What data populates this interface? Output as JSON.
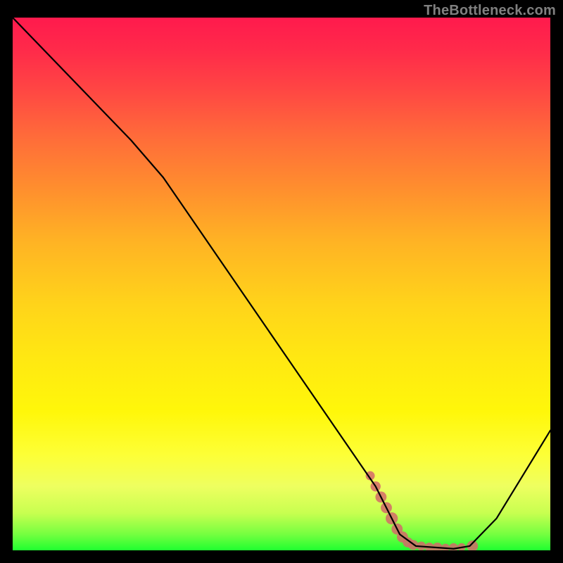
{
  "watermark_text": "TheBottleneck.com",
  "chart_data": {
    "type": "line",
    "title": "",
    "xlabel": "",
    "ylabel": "",
    "xlim": [
      0,
      100
    ],
    "ylim": [
      0,
      100
    ],
    "curve": {
      "name": "bottleneck-curve",
      "color": "#000000",
      "points_pct": [
        {
          "x": 0.0,
          "y": 100.0
        },
        {
          "x": 22.0,
          "y": 77.0
        },
        {
          "x": 28.0,
          "y": 70.0
        },
        {
          "x": 67.5,
          "y": 12.0
        },
        {
          "x": 72.0,
          "y": 3.0
        },
        {
          "x": 75.0,
          "y": 0.8
        },
        {
          "x": 82.0,
          "y": 0.3
        },
        {
          "x": 85.0,
          "y": 0.8
        },
        {
          "x": 90.0,
          "y": 6.0
        },
        {
          "x": 100.0,
          "y": 22.5
        }
      ]
    },
    "scatter": {
      "name": "data-band",
      "color": "#d46a6a",
      "points_pct": [
        {
          "x": 66.5,
          "y": 14.0,
          "r": 1.8
        },
        {
          "x": 67.5,
          "y": 12.0,
          "r": 2.0
        },
        {
          "x": 68.5,
          "y": 10.0,
          "r": 2.2
        },
        {
          "x": 69.5,
          "y": 8.0,
          "r": 2.2
        },
        {
          "x": 70.5,
          "y": 6.0,
          "r": 2.4
        },
        {
          "x": 71.5,
          "y": 4.0,
          "r": 2.2
        },
        {
          "x": 72.5,
          "y": 2.5,
          "r": 2.2
        },
        {
          "x": 73.5,
          "y": 1.5,
          "r": 2.0
        },
        {
          "x": 74.5,
          "y": 1.0,
          "r": 2.0
        },
        {
          "x": 76.0,
          "y": 0.8,
          "r": 1.8
        },
        {
          "x": 77.5,
          "y": 0.6,
          "r": 1.8
        },
        {
          "x": 79.0,
          "y": 0.5,
          "r": 2.0
        },
        {
          "x": 80.5,
          "y": 0.5,
          "r": 1.6
        },
        {
          "x": 82.0,
          "y": 0.5,
          "r": 1.8
        },
        {
          "x": 83.5,
          "y": 0.6,
          "r": 1.6
        },
        {
          "x": 85.5,
          "y": 0.8,
          "r": 2.2
        }
      ]
    },
    "gradient_stops": [
      {
        "pos": 0.0,
        "color": "#ff1a4d"
      },
      {
        "pos": 0.5,
        "color": "#ffd41a"
      },
      {
        "pos": 0.8,
        "color": "#fdff36"
      },
      {
        "pos": 1.0,
        "color": "#1fff30"
      }
    ]
  }
}
